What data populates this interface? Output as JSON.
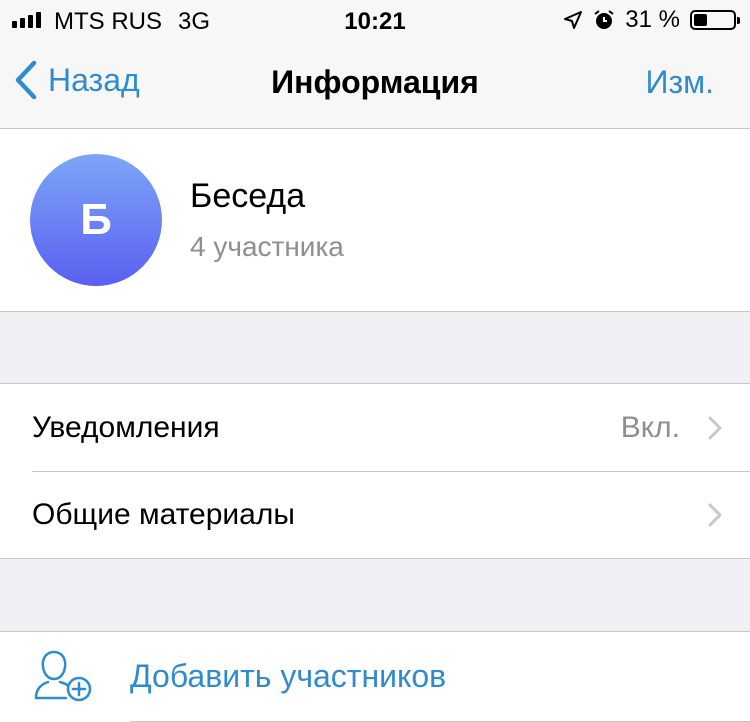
{
  "status_bar": {
    "carrier": "MTS RUS",
    "network": "3G",
    "time": "10:21",
    "battery_percent": "31 %",
    "battery_level": 0.31
  },
  "nav": {
    "back_label": "Назад",
    "title": "Информация",
    "edit_label": "Изм."
  },
  "chat": {
    "avatar_letter": "Б",
    "name": "Беседа",
    "members": "4 участника"
  },
  "settings": {
    "items": [
      {
        "label": "Уведомления",
        "value": "Вкл."
      },
      {
        "label": "Общие материалы",
        "value": ""
      }
    ]
  },
  "actions": {
    "add_members_label": "Добавить участников"
  },
  "colors": {
    "accent": "#2f8bce",
    "background": "#efeff4",
    "secondary_text": "#8e8e93"
  }
}
